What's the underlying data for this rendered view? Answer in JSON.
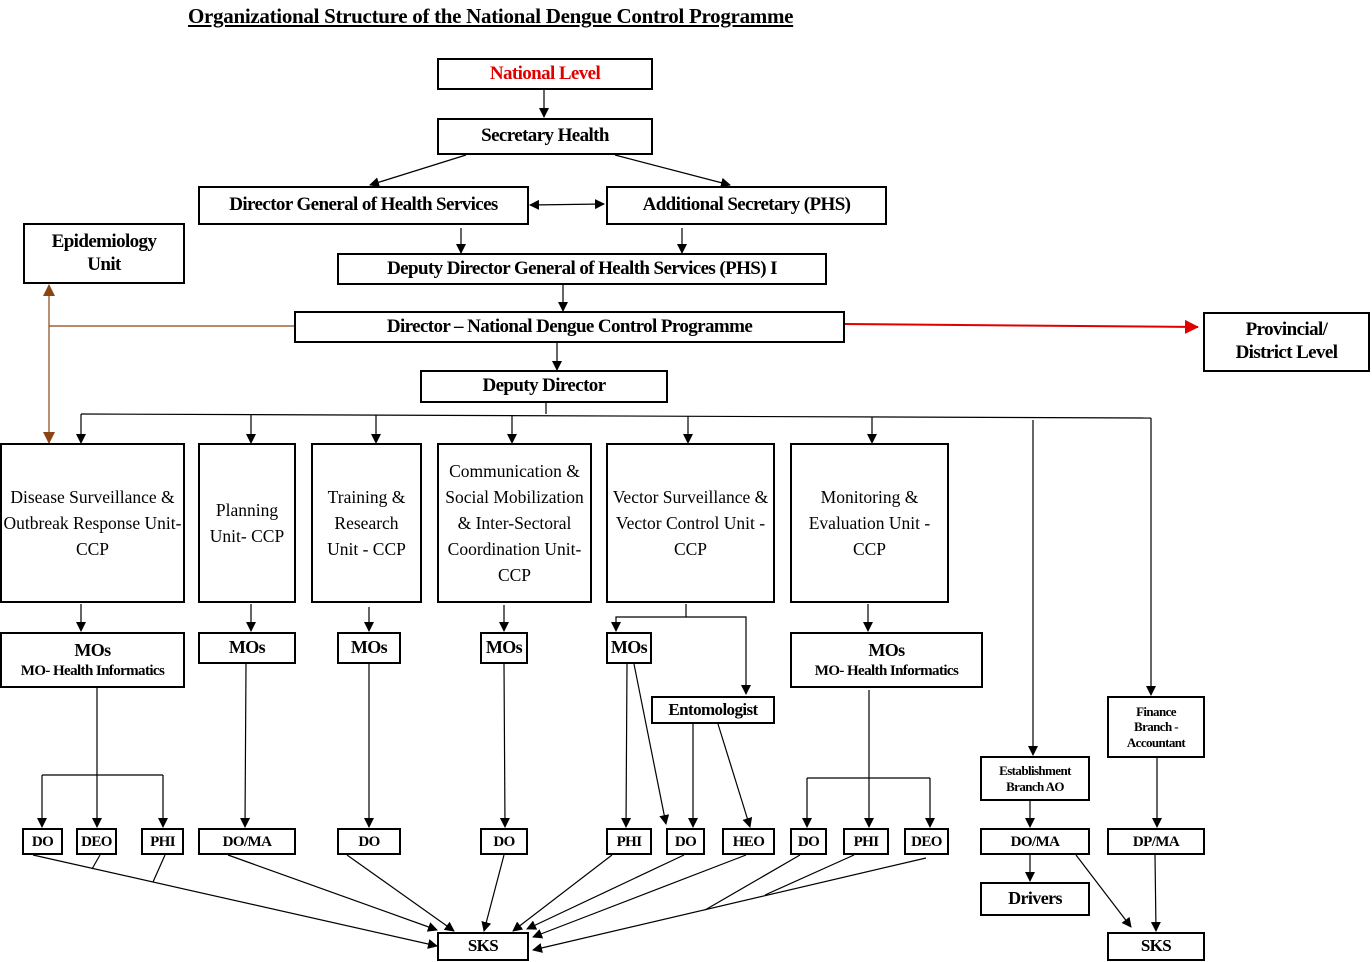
{
  "title": "Organizational Structure of the National Dengue Control Programme",
  "colors": {
    "highlight": "#e00000",
    "epi_link": "#8b4513",
    "line": "#000000"
  },
  "nodes": {
    "national_level": "National Level",
    "secretary_health": "Secretary Health",
    "dghs": "Director General of Health Services",
    "add_secretary": "Additional Secretary (PHS)",
    "epidemiology": "Epidemiology Unit",
    "ddg": "Deputy Director General of Health Services (PHS) I",
    "director": "Director – National Dengue Control Programme",
    "provincial": "Provincial/ District Level",
    "deputy_director": "Deputy Director"
  },
  "units": [
    {
      "label": "Disease Surveillance & Outbreak Response Unit- CCP"
    },
    {
      "label": "Planning Unit- CCP"
    },
    {
      "label": "Training & Research Unit - CCP"
    },
    {
      "label": "Communication & Social Mobilization & Inter-Sectoral Coordination Unit- CCP"
    },
    {
      "label": "Vector Surveillance & Vector Control Unit - CCP"
    },
    {
      "label": "Monitoring & Evaluation Unit - CCP"
    }
  ],
  "mos": {
    "mos": "MOs",
    "mo_hi": "MO- Health Informatics",
    "entomologist": "Entomologist",
    "establishment": "Establishment Branch AO",
    "finance": "Finance Branch - Accountant"
  },
  "staff": {
    "do": "DO",
    "deo": "DEO",
    "phi": "PHI",
    "doma": "DO/MA",
    "heo": "HEO",
    "dpma": "DP/MA",
    "drivers": "Drivers",
    "sks": "SKS"
  }
}
